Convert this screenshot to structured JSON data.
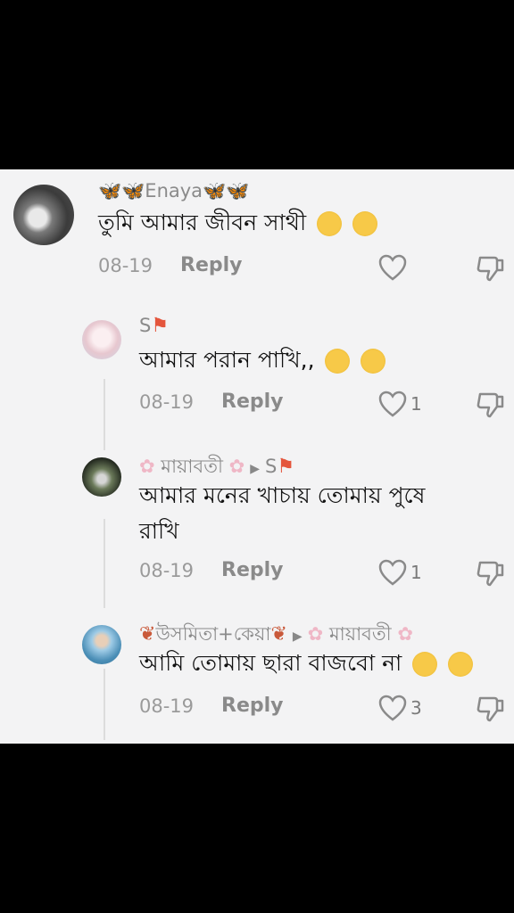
{
  "comments": [
    {
      "author": "🦋🦋Enaya🦋🦋",
      "text": "তুমি আমার জীবন সাথী",
      "date": "08-19",
      "reply": "Reply",
      "likes": ""
    },
    {
      "author": "S",
      "text": "আমার পরান পাখি,,",
      "date": "08-19",
      "reply": "Reply",
      "likes": "1"
    },
    {
      "author": "মায়াবতী",
      "reply_to": "S",
      "text_line1": "আমার মনের খাচায় তোমায় পুষে",
      "text_line2": "রাখি",
      "date": "08-19",
      "reply": "Reply",
      "likes": "1"
    },
    {
      "author": "উসমিতা+কেয়া",
      "reply_to": "মায়াবতী",
      "text": "আমি তোমায় ছারা বাজবো না",
      "date": "08-19",
      "reply": "Reply",
      "likes": "3"
    }
  ],
  "colors": {
    "background": "#000000",
    "panel": "#f3f3f4",
    "flag": "#e4553c",
    "sakura": "#efb7c6"
  }
}
